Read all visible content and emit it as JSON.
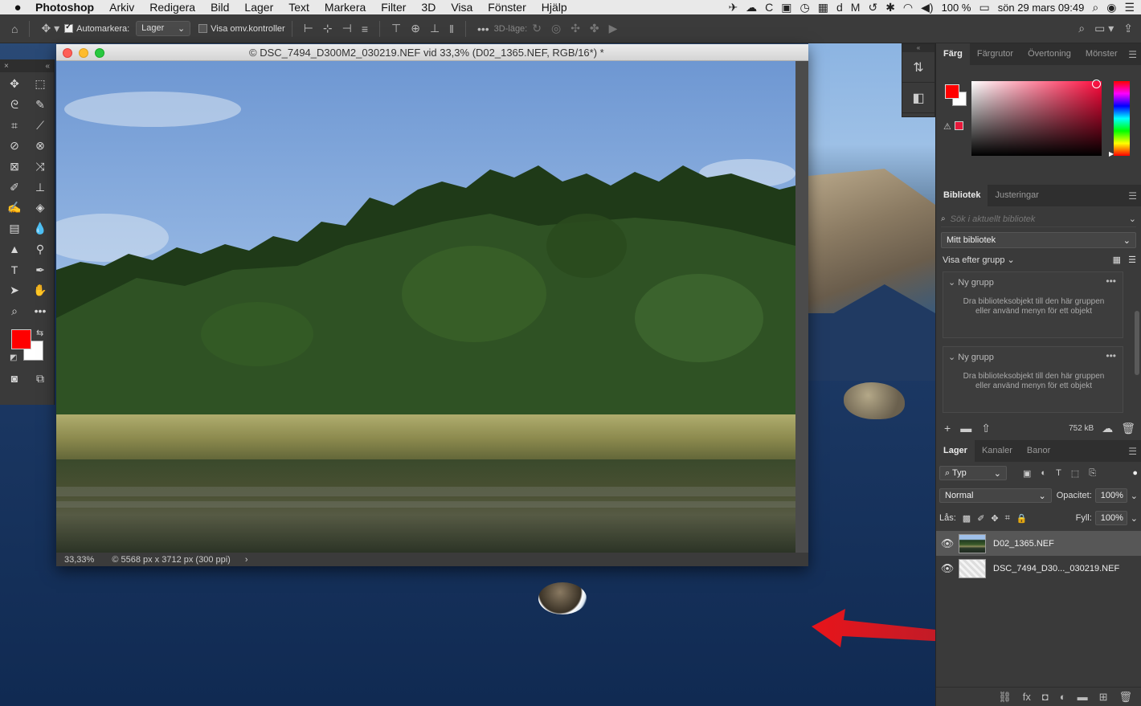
{
  "menubar": {
    "app_name": "Photoshop",
    "items": [
      "Arkiv",
      "Redigera",
      "Bild",
      "Lager",
      "Text",
      "Markera",
      "Filter",
      "3D",
      "Visa",
      "Fönster",
      "Hjälp"
    ],
    "battery": "100 %",
    "datetime": "sön 29 mars  09:49"
  },
  "options": {
    "automarkera_label": "Automarkera:",
    "automarkera_checked": true,
    "automarkera_target": "Lager",
    "show_transform_label": "Visa omv.kontroller",
    "show_transform_checked": false,
    "mode3d_label": "3D-läge:"
  },
  "document": {
    "title": "© DSC_7494_D300M2_030219.NEF vid 33,3% (D02_1365.NEF, RGB/16*) *",
    "zoom": "33,33%",
    "dimensions": "© 5568 px x 3712 px (300 ppi)",
    "status_more": "›"
  },
  "panels": {
    "color": {
      "tabs": [
        "Färg",
        "Färgrutor",
        "Övertoning",
        "Mönster"
      ],
      "active_tab": "Färg",
      "foreground": "#ff0000",
      "background": "#ffffff",
      "hue_base": "#ff0a3c",
      "out_of_gamut_swatch": "#e8183a"
    },
    "libraries": {
      "tabs": [
        "Bibliotek",
        "Justeringar"
      ],
      "active_tab": "Bibliotek",
      "search_placeholder": "Sök i aktuellt bibliotek",
      "library_name": "Mitt bibliotek",
      "view_by": "Visa efter grupp",
      "groups": [
        {
          "name": "Ny grupp",
          "hint": "Dra biblioteksobjekt till den här gruppen eller använd menyn för ett objekt"
        },
        {
          "name": "Ny grupp",
          "hint": "Dra biblioteksobjekt till den här gruppen eller använd menyn för ett objekt"
        }
      ],
      "size": "752 kB"
    },
    "layers": {
      "tabs": [
        "Lager",
        "Kanaler",
        "Banor"
      ],
      "active_tab": "Lager",
      "filter_kind": "Typ",
      "blend_mode": "Normal",
      "opacity_label": "Opacitet:",
      "opacity": "100%",
      "lock_label": "Lås:",
      "fill_label": "Fyll:",
      "fill": "100%",
      "items": [
        {
          "name": "D02_1365.NEF",
          "visible": true,
          "selected": true
        },
        {
          "name": "DSC_7494_D30..._030219.NEF",
          "visible": true,
          "selected": false
        }
      ]
    }
  },
  "toolbar": {
    "foreground": "#ff0000",
    "background": "#ffffff"
  }
}
